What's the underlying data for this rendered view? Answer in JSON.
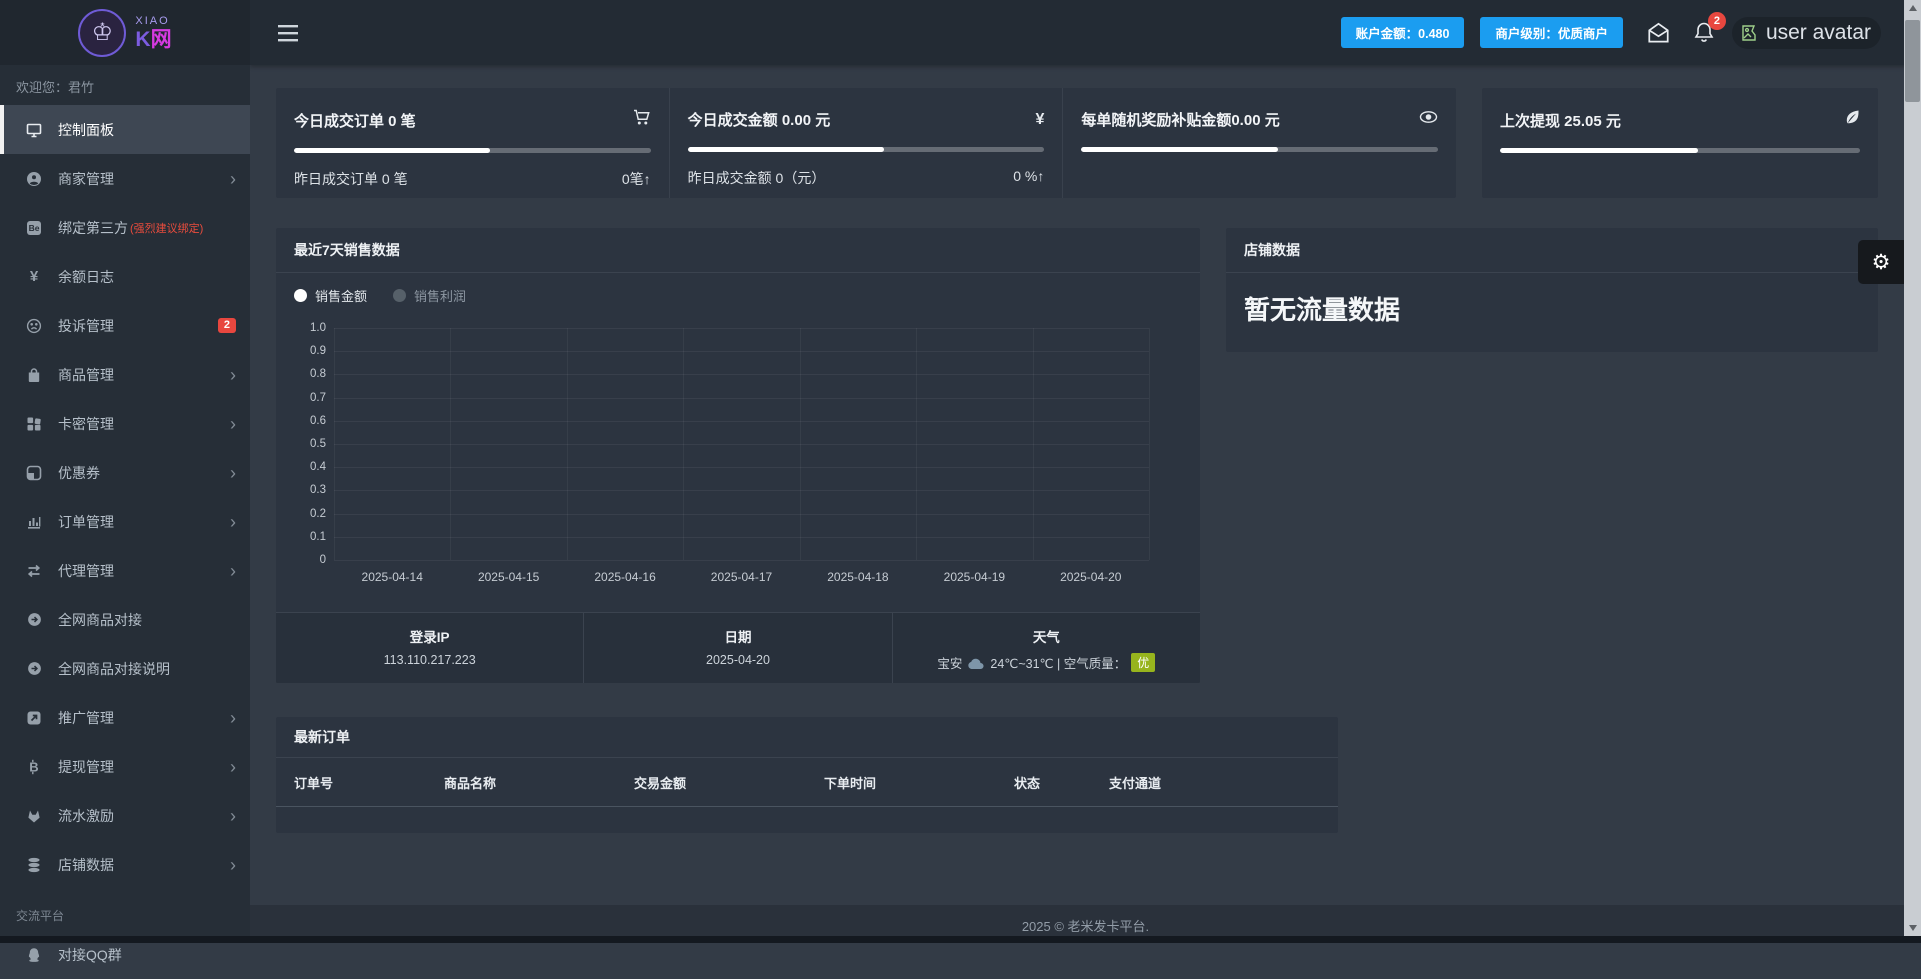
{
  "colors": {
    "accent_blue": "#1b9df0",
    "badge_red": "#e8473f",
    "aqi_green": "#97b41d",
    "brand_purple": "#7c5ce0",
    "brand_magenta": "#d63ae1",
    "legend_white": "#ffffff",
    "legend_gray": "#566069"
  },
  "sidebar": {
    "logo": {
      "xiao": "XIAO",
      "kw_k": "K",
      "kw_net": "网",
      "mark": "♔"
    },
    "greeting": "欢迎您：君竹",
    "section_label": "交流平台",
    "items": [
      {
        "label": "控制面板",
        "icon": "monitor-icon",
        "active": true
      },
      {
        "label": "商家管理",
        "icon": "person-icon",
        "chevron": true
      },
      {
        "label": "绑定第三方",
        "icon": "be-icon",
        "suffix": "(强烈建议绑定)"
      },
      {
        "label": "余额日志",
        "icon": "yen-icon"
      },
      {
        "label": "投诉管理",
        "icon": "frown-icon",
        "badge": "2"
      },
      {
        "label": "商品管理",
        "icon": "bag-icon",
        "chevron": true
      },
      {
        "label": "卡密管理",
        "icon": "grid-icon",
        "chevron": true
      },
      {
        "label": "优惠券",
        "icon": "coupon-icon",
        "chevron": true
      },
      {
        "label": "订单管理",
        "icon": "barchart-icon",
        "chevron": true
      },
      {
        "label": "代理管理",
        "icon": "swap-icon",
        "chevron": true
      },
      {
        "label": "全网商品对接",
        "icon": "arrow-circle-icon"
      },
      {
        "label": "全网商品对接说明",
        "icon": "arrow-circle-icon"
      },
      {
        "label": "推广管理",
        "icon": "external-icon",
        "chevron": true
      },
      {
        "label": "提现管理",
        "icon": "bitcoin-icon",
        "chevron": true
      },
      {
        "label": "流水激励",
        "icon": "fox-icon",
        "chevron": true
      },
      {
        "label": "店铺数据",
        "icon": "database-icon",
        "chevron": true
      },
      {
        "type": "section",
        "label": "交流平台"
      },
      {
        "label": "对接QQ群",
        "icon": "qq-icon"
      }
    ]
  },
  "topbar": {
    "account_balance_button": "账户金额：0.480",
    "merchant_level_button": "商户级别：优质商户",
    "notification_count": "2",
    "avatar_alt": "user avatar"
  },
  "stat_cards": [
    {
      "title": "今日成交订单 0 笔",
      "icon": "cart-icon",
      "progress_pct": 55,
      "bottom_left": "昨日成交订单 0 笔",
      "bottom_right": "0笔↑"
    },
    {
      "title": "今日成交金额 0.00 元",
      "icon": "yen-icon",
      "progress_pct": 55,
      "bottom_left": "昨日成交金额 0（元）",
      "bottom_right": "0 %↑"
    },
    {
      "title": "每单随机奖励补贴金额0.00 元",
      "icon": "eye-icon",
      "progress_pct": 55,
      "bottom_left": "",
      "bottom_right": ""
    },
    {
      "title": "上次提现 25.05 元",
      "icon": "leaf-icon",
      "progress_pct": 55,
      "bottom_left": "",
      "bottom_right": ""
    }
  ],
  "chart_panel": {
    "title": "最近7天销售数据",
    "legend": [
      {
        "label": "销售金额",
        "color": "#ffffff",
        "text_color": "#e3e8ec"
      },
      {
        "label": "销售利润",
        "color": "#566069",
        "text_color": "#8d97a2"
      }
    ]
  },
  "chart_data": {
    "type": "line",
    "title": "最近7天销售数据",
    "x": [
      "2025-04-14",
      "2025-04-15",
      "2025-04-16",
      "2025-04-17",
      "2025-04-18",
      "2025-04-19",
      "2025-04-20"
    ],
    "series": [
      {
        "name": "销售金额",
        "values": [
          0,
          0,
          0,
          0,
          0,
          0,
          0
        ]
      },
      {
        "name": "销售利润",
        "values": [
          0,
          0,
          0,
          0,
          0,
          0,
          0
        ]
      }
    ],
    "ylim": [
      0,
      1.0
    ],
    "yticks": [
      "1.0",
      "0.9",
      "0.8",
      "0.7",
      "0.6",
      "0.5",
      "0.4",
      "0.3",
      "0.2",
      "0.1",
      "0"
    ],
    "grid": true,
    "legend_position": "top-left"
  },
  "info_row": {
    "login_ip_label": "登录IP",
    "login_ip_value": "113.110.217.223",
    "date_label": "日期",
    "date_value": "2025-04-20",
    "weather_label": "天气",
    "weather_city": "宝安",
    "weather_text": "24℃~31℃ | 空气质量：",
    "weather_badge": "优"
  },
  "shop_panel": {
    "title": "店铺数据",
    "empty_text": "暂无流量数据"
  },
  "orders_panel": {
    "title": "最新订单",
    "columns": [
      "订单号",
      "商品名称",
      "交易金额",
      "下单时间",
      "状态",
      "支付通道"
    ]
  },
  "footer": {
    "copyright": "2025 © 老米发卡平台."
  }
}
